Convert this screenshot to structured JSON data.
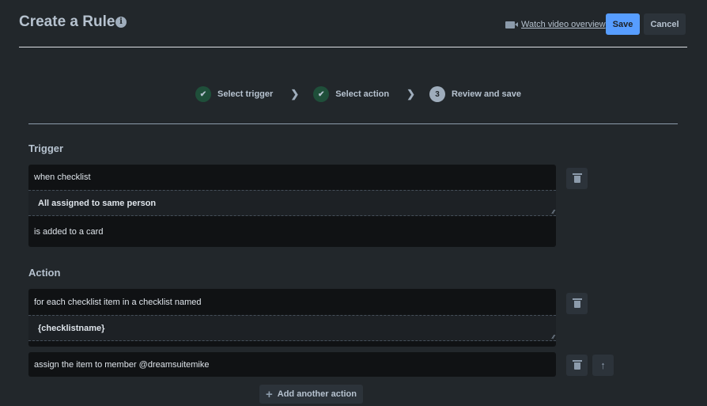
{
  "header": {
    "title": "Create a Rule",
    "info_icon": "i",
    "video_link": "Watch video overview",
    "save": "Save",
    "cancel": "Cancel"
  },
  "steps": [
    {
      "label": "Select trigger",
      "status": "done",
      "marker": "✔"
    },
    {
      "label": "Select action",
      "status": "done",
      "marker": "✔"
    },
    {
      "label": "Review and save",
      "status": "current",
      "marker": "3"
    }
  ],
  "trigger": {
    "heading": "Trigger",
    "line1": "when checklist",
    "field": "All assigned to same person",
    "line2": "is added to a card"
  },
  "action": {
    "heading": "Action",
    "action1_line1": "for each checklist item in a checklist named",
    "action1_field": "{checklistname}",
    "action2": "assign the item to member @dreamsuitemike",
    "add_button": "Add another action"
  }
}
